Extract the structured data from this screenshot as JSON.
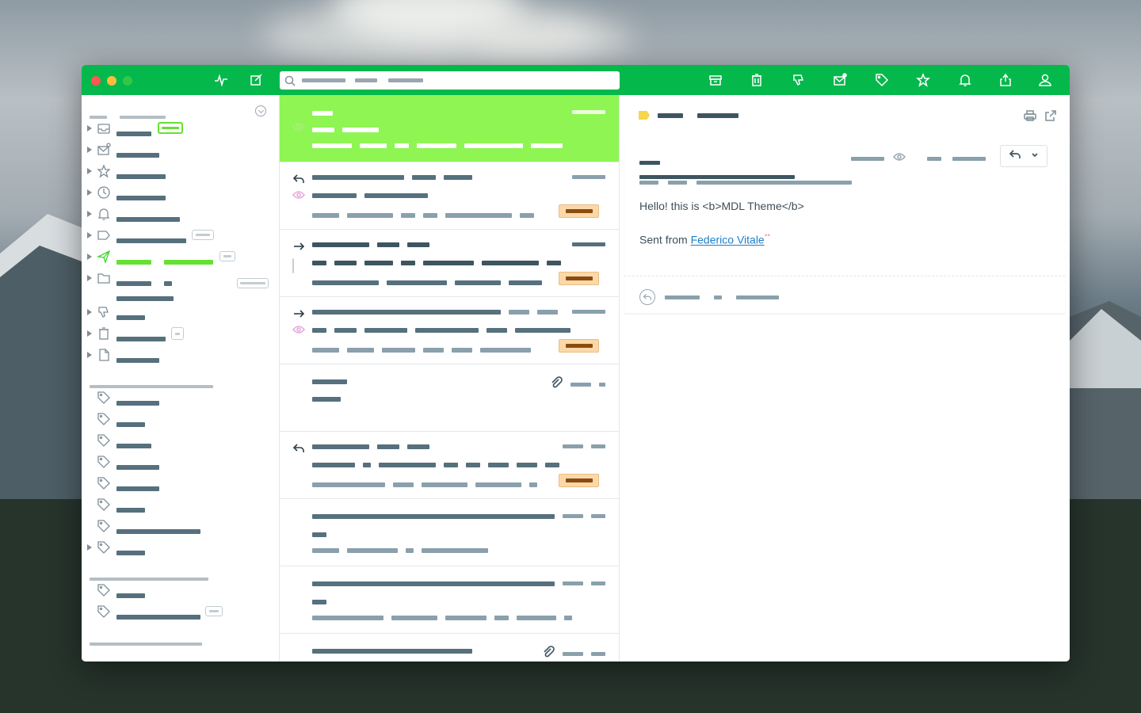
{
  "window": {
    "title": "",
    "accent_color": "#05b84c",
    "selected_color": "#8ef553"
  },
  "toolbar": {
    "search_placeholder": "",
    "icons": [
      "activity-icon",
      "compose-icon",
      "archive-icon",
      "trash-icon",
      "spam-icon",
      "mark-unread-icon",
      "label-icon",
      "star-icon",
      "bell-icon",
      "share-icon",
      "account-icon"
    ]
  },
  "sidebar": {
    "folders": [
      {
        "icon": "inbox-icon"
      },
      {
        "icon": "unread-mail-icon"
      },
      {
        "icon": "star-icon"
      },
      {
        "icon": "clock-icon"
      },
      {
        "icon": "bell-icon"
      },
      {
        "icon": "label-icon"
      },
      {
        "icon": "send-icon"
      },
      {
        "icon": "folder-icon"
      },
      {
        "icon": "spam-icon"
      },
      {
        "icon": "trash-icon"
      },
      {
        "icon": "draft-icon"
      }
    ],
    "labels_icon": "tag-icon"
  },
  "reader": {
    "body_line1": "Hello! this is <b>MDL Theme</b>",
    "body_line2_prefix": "Sent from ",
    "sender_link": "Federico Vitale",
    "sender_suffix": "°°",
    "tag_color": "#f6d64a",
    "link_color": "#1e7fc8"
  }
}
